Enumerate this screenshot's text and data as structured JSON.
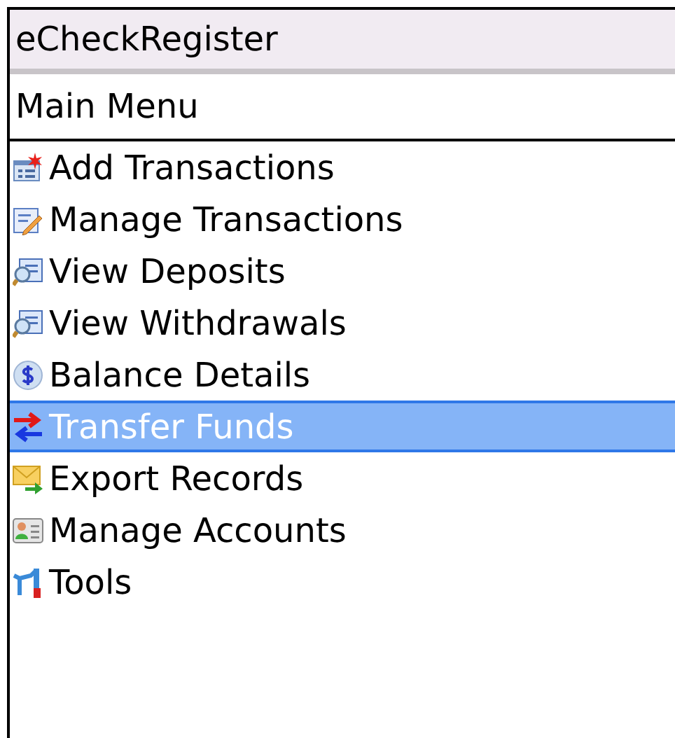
{
  "window": {
    "title": "eCheckRegister"
  },
  "screen_title": "Main Menu",
  "menu": [
    {
      "label": "Add Transactions",
      "kind": "add",
      "selected": false
    },
    {
      "label": "Manage Transactions",
      "kind": "edit",
      "selected": false
    },
    {
      "label": "View Deposits",
      "kind": "view",
      "selected": false
    },
    {
      "label": "View Withdrawals",
      "kind": "view",
      "selected": false
    },
    {
      "label": "Balance Details",
      "kind": "balance",
      "selected": false
    },
    {
      "label": "Transfer Funds",
      "kind": "transfer",
      "selected": true
    },
    {
      "label": "Export Records",
      "kind": "export",
      "selected": false
    },
    {
      "label": "Manage Accounts",
      "kind": "accounts",
      "selected": false
    },
    {
      "label": "Tools",
      "kind": "tools",
      "selected": false
    }
  ]
}
